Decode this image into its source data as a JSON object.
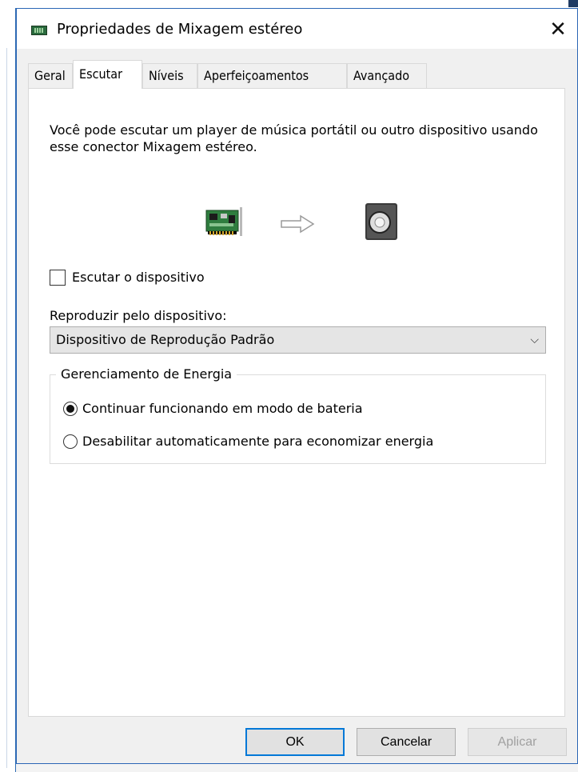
{
  "dialog": {
    "title": "Propriedades de Mixagem estéreo",
    "close_glyph": "✕"
  },
  "tabs": [
    {
      "label": "Geral",
      "active": false
    },
    {
      "label": "Escutar",
      "active": true
    },
    {
      "label": "Níveis",
      "active": false
    },
    {
      "label": "Aperfeiçoamentos",
      "active": false
    },
    {
      "label": "Avançado",
      "active": false
    }
  ],
  "listen": {
    "description": "Você pode escutar um player de música portátil ou outro dispositivo usando esse conector Mixagem estéreo.",
    "checkbox_label": "Escutar o dispositivo",
    "checkbox_checked": false,
    "playback_label": "Reproduzir pelo dispositivo:",
    "playback_value": "Dispositivo de Reprodução Padrão"
  },
  "power": {
    "group_title": "Gerenciamento de Energia",
    "options": [
      {
        "label": "Continuar funcionando em modo de bateria",
        "selected": true
      },
      {
        "label": "Desabilitar automaticamente para economizar energia",
        "selected": false
      }
    ]
  },
  "buttons": {
    "ok": "OK",
    "cancel": "Cancelar",
    "apply": "Aplicar"
  },
  "icons": {
    "title": "sound-card-icon",
    "card": "sound-card-icon",
    "arrow": "arrow-right-icon",
    "speaker": "speaker-icon"
  }
}
